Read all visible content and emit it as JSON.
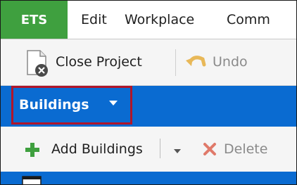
{
  "menubar": {
    "app_label": "ETS",
    "items": [
      "Edit",
      "Workplace",
      "Comm"
    ]
  },
  "toolbar": {
    "close_project_label": "Close Project",
    "undo_label": "Undo"
  },
  "ribbon": {
    "tab_label": "Buildings"
  },
  "toolbar2": {
    "add_buildings_label": "Add Buildings",
    "delete_label": "Delete"
  },
  "colors": {
    "accent_green": "#3fa03f",
    "ribbon_blue": "#0a6bd1",
    "highlight_red": "#b0152a"
  }
}
